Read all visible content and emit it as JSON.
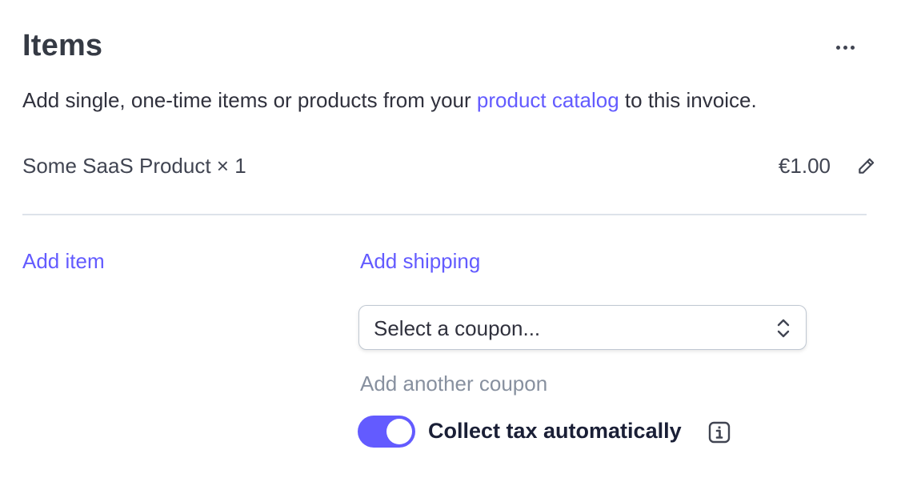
{
  "header": {
    "title": "Items",
    "menu_icon": "more-horizontal-icon"
  },
  "description": {
    "before_link": "Add single, one-time items or products from your ",
    "link_text": "product catalog",
    "after_link": " to this invoice."
  },
  "line_items": [
    {
      "name": "Some SaaS Product × 1",
      "price": "€1.00",
      "edit_icon": "pencil-icon"
    }
  ],
  "actions": {
    "add_item": "Add item",
    "add_shipping": "Add shipping",
    "add_another_coupon": "Add another coupon"
  },
  "coupon": {
    "selected": "Select a coupon...",
    "icon": "chevron-up-down-icon"
  },
  "tax": {
    "label": "Collect tax automatically",
    "enabled": true,
    "info_icon": "info-icon"
  },
  "colors": {
    "accent": "#635bff",
    "muted_link": "#87909f",
    "divider": "#dde3ea"
  }
}
